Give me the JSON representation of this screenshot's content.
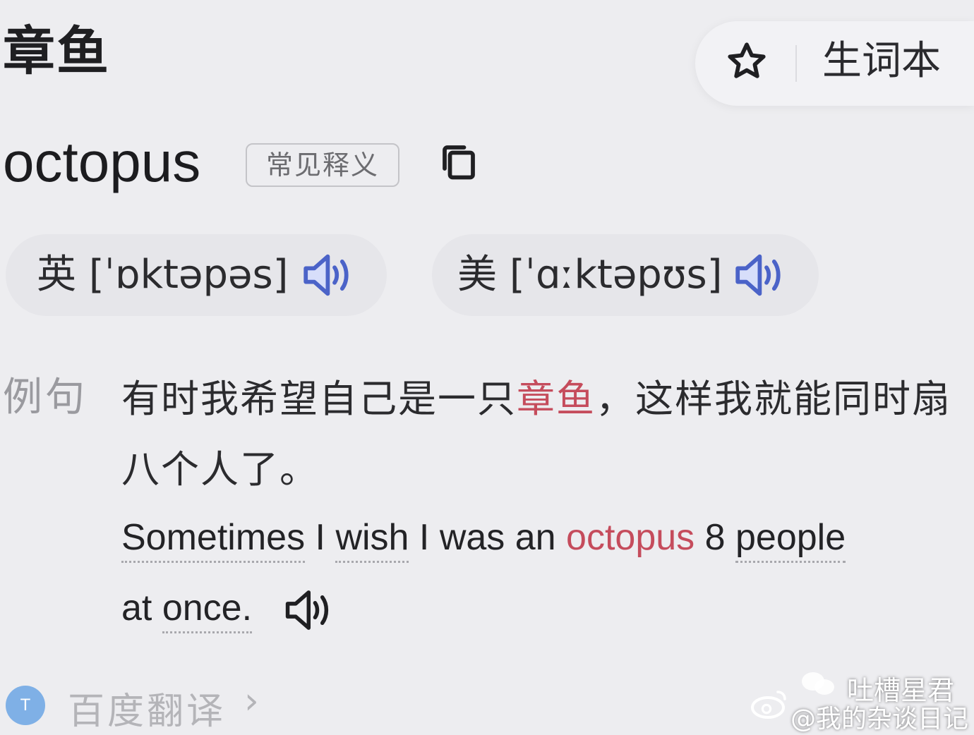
{
  "query": {
    "text": "章鱼"
  },
  "vocab_button": {
    "label": "生词本",
    "icon": "star-outline-icon"
  },
  "entry": {
    "word": "octopus",
    "tag": "常见释义",
    "copy_icon": "copy-icon"
  },
  "pronunciations": [
    {
      "region": "英",
      "ipa": "[ˈɒktəpəs]",
      "icon": "speaker-icon"
    },
    {
      "region": "美",
      "ipa": "[ˈɑːktəpʊs]",
      "icon": "speaker-icon"
    }
  ],
  "example": {
    "label": "例句",
    "zh": {
      "before": "有时我希望自己是一只",
      "highlight": "章鱼",
      "after": "，这样我就能同时扇八个人了。"
    },
    "en": {
      "w1": "Sometimes",
      "w2": "I",
      "w3": "wish",
      "w4": "I was an",
      "highlight": "octopus",
      "w5": "8",
      "w6": "people",
      "w7": "at",
      "w8": "once."
    },
    "speaker_icon": "speaker-icon"
  },
  "footer": {
    "label": "百度翻译",
    "chevron": "›",
    "icon_text": "T"
  },
  "watermark": {
    "channel": "吐槽星君",
    "handle": "@我的杂谈日记"
  },
  "colors": {
    "background": "#ededf0",
    "highlight": "#c54c5c",
    "speaker_blue": "#4b63c8"
  }
}
